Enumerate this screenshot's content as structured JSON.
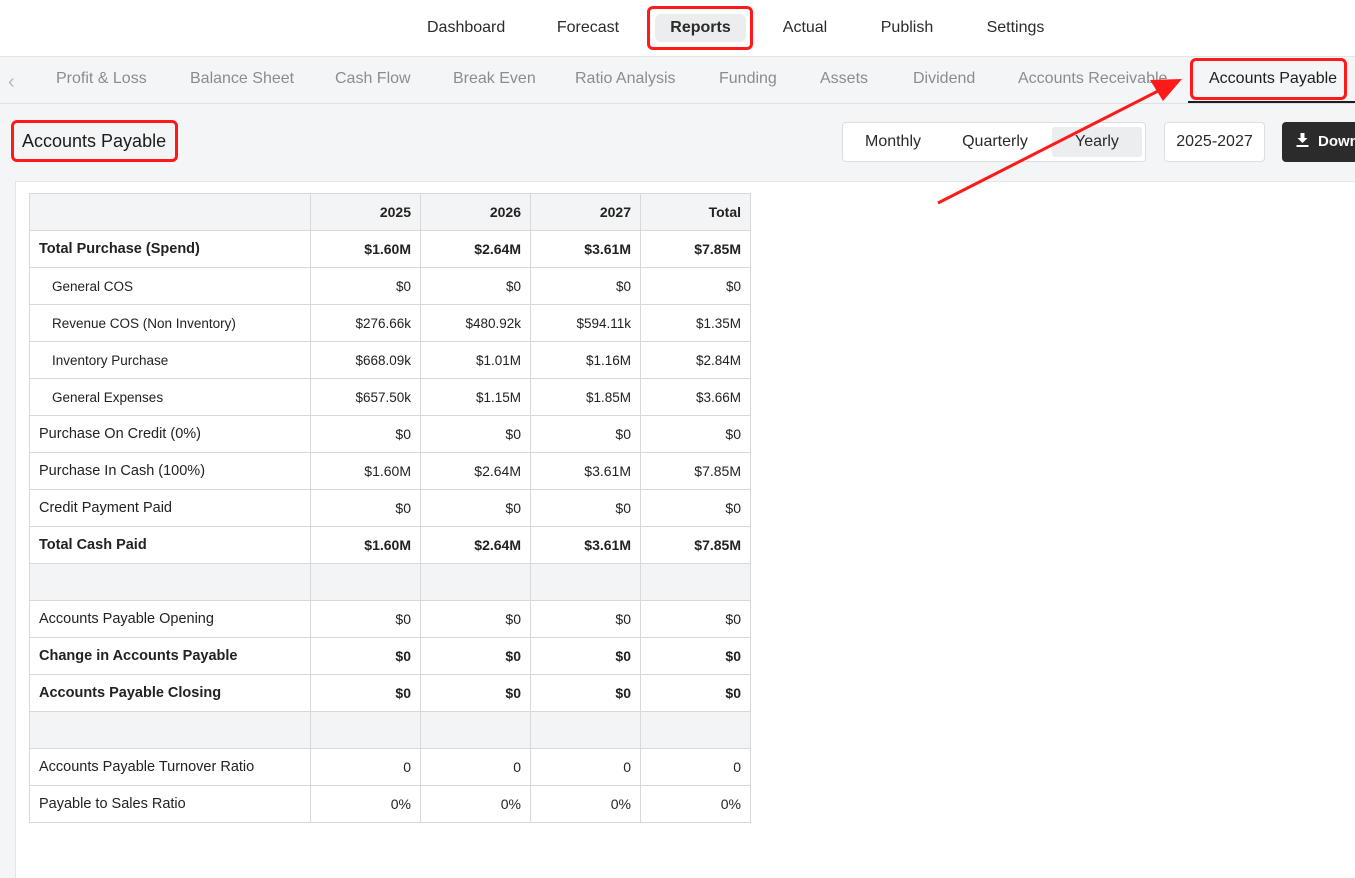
{
  "topnav": {
    "items": [
      "Dashboard",
      "Forecast",
      "Reports",
      "Actual",
      "Publish",
      "Settings"
    ],
    "active": "Reports"
  },
  "subnav": {
    "tabs": [
      "Profit & Loss",
      "Balance Sheet",
      "Cash Flow",
      "Break Even",
      "Ratio Analysis",
      "Funding",
      "Assets",
      "Dividend",
      "Accounts Receivable",
      "Accounts Payable"
    ],
    "active": "Accounts Payable",
    "prev_icon": "chevron-left-icon"
  },
  "header": {
    "title": "Accounts Payable",
    "periods": [
      "Monthly",
      "Quarterly",
      "Yearly"
    ],
    "active_period": "Yearly",
    "range": "2025-2027",
    "download_label": "Down",
    "download_icon": "download-icon"
  },
  "table": {
    "columns": [
      "",
      "2025",
      "2026",
      "2027",
      "Total"
    ],
    "rows": [
      {
        "label": "Total Purchase (Spend)",
        "values": [
          "$1.60M",
          "$2.64M",
          "$3.61M",
          "$7.85M"
        ],
        "style": "bold"
      },
      {
        "label": "General COS",
        "values": [
          "$0",
          "$0",
          "$0",
          "$0"
        ],
        "style": "sub"
      },
      {
        "label": "Revenue COS (Non Inventory)",
        "values": [
          "$276.66k",
          "$480.92k",
          "$594.11k",
          "$1.35M"
        ],
        "style": "sub"
      },
      {
        "label": "Inventory Purchase",
        "values": [
          "$668.09k",
          "$1.01M",
          "$1.16M",
          "$2.84M"
        ],
        "style": "sub"
      },
      {
        "label": "General Expenses",
        "values": [
          "$657.50k",
          "$1.15M",
          "$1.85M",
          "$3.66M"
        ],
        "style": "sub"
      },
      {
        "label": "Purchase On Credit (0%)",
        "values": [
          "$0",
          "$0",
          "$0",
          "$0"
        ],
        "style": "normal"
      },
      {
        "label": "Purchase In Cash (100%)",
        "values": [
          "$1.60M",
          "$2.64M",
          "$3.61M",
          "$7.85M"
        ],
        "style": "normal"
      },
      {
        "label": "Credit Payment Paid",
        "values": [
          "$0",
          "$0",
          "$0",
          "$0"
        ],
        "style": "normal"
      },
      {
        "label": "Total Cash Paid",
        "values": [
          "$1.60M",
          "$2.64M",
          "$3.61M",
          "$7.85M"
        ],
        "style": "bold"
      },
      {
        "label": "",
        "values": [
          "",
          "",
          "",
          ""
        ],
        "style": "shaded"
      },
      {
        "label": "Accounts Payable Opening",
        "values": [
          "$0",
          "$0",
          "$0",
          "$0"
        ],
        "style": "normal"
      },
      {
        "label": "Change in Accounts Payable",
        "values": [
          "$0",
          "$0",
          "$0",
          "$0"
        ],
        "style": "bold"
      },
      {
        "label": "Accounts Payable Closing",
        "values": [
          "$0",
          "$0",
          "$0",
          "$0"
        ],
        "style": "bold"
      },
      {
        "label": "",
        "values": [
          "",
          "",
          "",
          ""
        ],
        "style": "shaded"
      },
      {
        "label": "Accounts Payable Turnover Ratio",
        "values": [
          "0",
          "0",
          "0",
          "0"
        ],
        "style": "normal"
      },
      {
        "label": "Payable to Sales Ratio",
        "values": [
          "0%",
          "0%",
          "0%",
          "0%"
        ],
        "style": "normal"
      }
    ]
  },
  "colors": {
    "highlight": "#ff1a1a",
    "download_bg": "#2b2b2b"
  }
}
